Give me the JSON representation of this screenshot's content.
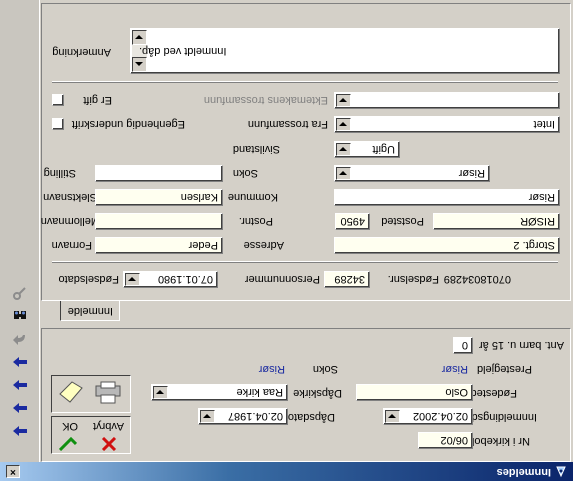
{
  "window": {
    "title": "Innmeldes",
    "close_label": "×"
  },
  "tabs": [
    {
      "label": "Innmelde"
    }
  ],
  "actions": {
    "ok_label": "OK",
    "cancel_label": "Avbryt"
  },
  "form": {
    "fornavn": {
      "label": "Fornavn",
      "value": "Peder"
    },
    "mellomnavn": {
      "label": "Mellomnavn",
      "value": ""
    },
    "slektsnavn": {
      "label": "Slektsnavn",
      "value": "Karlsen"
    },
    "stilling": {
      "label": "Stilling",
      "value": ""
    },
    "fodselsdato": {
      "label": "Fødselsdato",
      "value": "07.01.1980"
    },
    "personnummer": {
      "label": "Personnummer",
      "value": "34289"
    },
    "fodselsnr": {
      "label": "Fødselsnr.",
      "value": "07018034289"
    },
    "adresse": {
      "label": "Adresse",
      "value": "Storgt. 2"
    },
    "postnr": {
      "label": "Postnr.",
      "value": "4950"
    },
    "poststed": {
      "label": "Poststed",
      "value": "RISØR"
    },
    "kommune": {
      "label": "Kommune",
      "value": "Risør"
    },
    "sokn": {
      "label": "Sokn",
      "value": "Risør"
    },
    "sivilstand": {
      "label": "Sivilstand",
      "value": "Ugift"
    },
    "fra_trossamfunn": {
      "label": "Fra trossamfunn",
      "value": "Intet"
    },
    "ektemakens_trossamfunn": {
      "label": "Ektemakens trossamfunn",
      "value": ""
    },
    "egenhendig": {
      "label": "Egenhendig underskrift",
      "checked": false
    },
    "er_gift": {
      "label": "Er gift",
      "checked": false
    },
    "anmerkning": {
      "label": "Anmerkning",
      "value": "Innmeldt ved dåp."
    }
  },
  "lower": {
    "nr_kirkeboken": {
      "label": "Nr i kirkeboken",
      "value": "06/02"
    },
    "innmeldingsdato": {
      "label": "Innmeldingsdato",
      "value": "02.04.2002"
    },
    "dapsdato": {
      "label": "Dåpsdato",
      "value": "02.04.1987"
    },
    "fodested": {
      "label": "Fødested",
      "value": "Oslo"
    },
    "dapskirke": {
      "label": "Dåpskirke",
      "value": "Raa kirke"
    },
    "prestegjeld": {
      "label": "Prestegjeld",
      "value": "Risør"
    },
    "sokn2": {
      "label": "Sokn",
      "value": "Risør"
    },
    "ant_barn": {
      "label": "Ant. barn u. 15 år",
      "value": "0"
    }
  }
}
